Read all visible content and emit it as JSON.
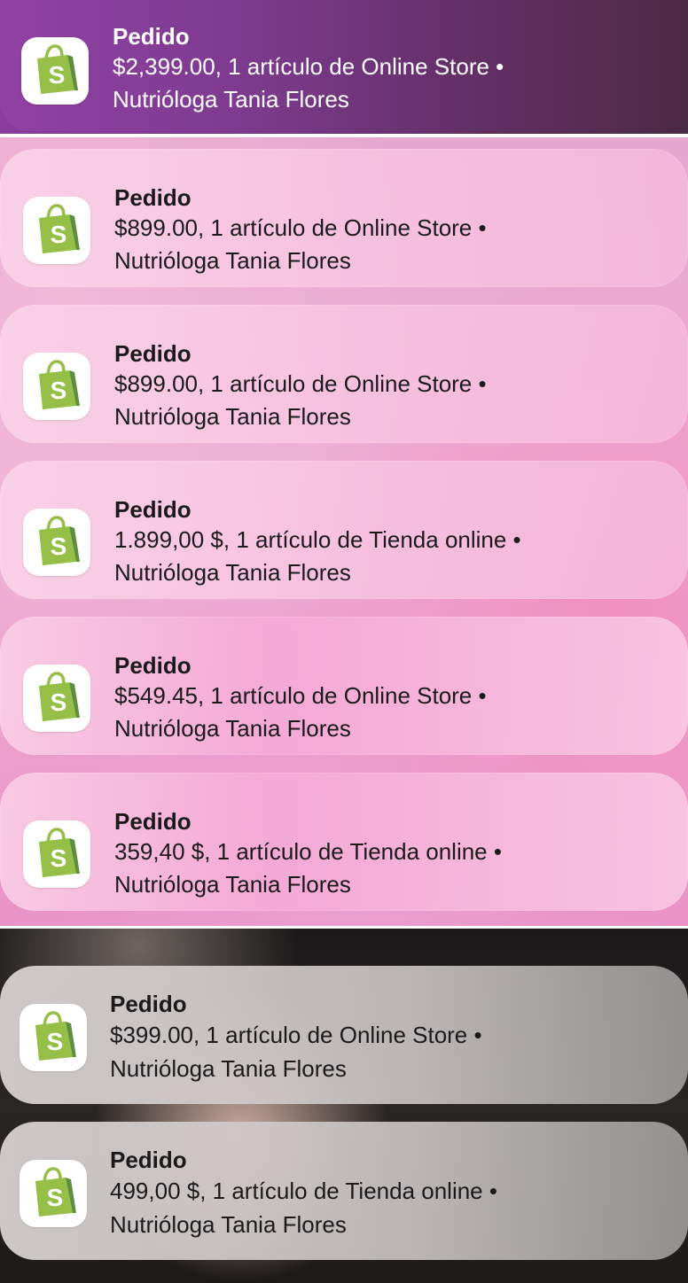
{
  "app_icon": "shopify-bag-icon",
  "colors": {
    "icon_green": "#95bf47",
    "icon_green_dark": "#5e8e3e"
  },
  "notifications": [
    {
      "title": "Pedido",
      "line1": "$2,399.00, 1 artículo de Online Store •",
      "line2": "Nutrióloga Tania Flores"
    },
    {
      "title": "Pedido",
      "line1": "$899.00, 1 artículo de Online Store •",
      "line2": "Nutrióloga Tania Flores"
    },
    {
      "title": "Pedido",
      "line1": "$899.00, 1 artículo de Online Store •",
      "line2": "Nutrióloga Tania Flores"
    },
    {
      "title": "Pedido",
      "line1": "1.899,00 $, 1 artículo de Tienda online •",
      "line2": "Nutrióloga Tania Flores"
    },
    {
      "title": "Pedido",
      "line1": "$549.45, 1 artículo de Online Store •",
      "line2": "Nutrióloga Tania Flores"
    },
    {
      "title": "Pedido",
      "line1": "359,40 $, 1 artículo de Tienda online •",
      "line2": "Nutrióloga Tania Flores"
    },
    {
      "title": "Pedido",
      "line1": "$399.00, 1 artículo de Online Store •",
      "line2": "Nutrióloga Tania Flores"
    },
    {
      "title": "Pedido",
      "line1": "499,00 $, 1 artículo de Tienda online •",
      "line2": "Nutrióloga Tania Flores"
    }
  ]
}
